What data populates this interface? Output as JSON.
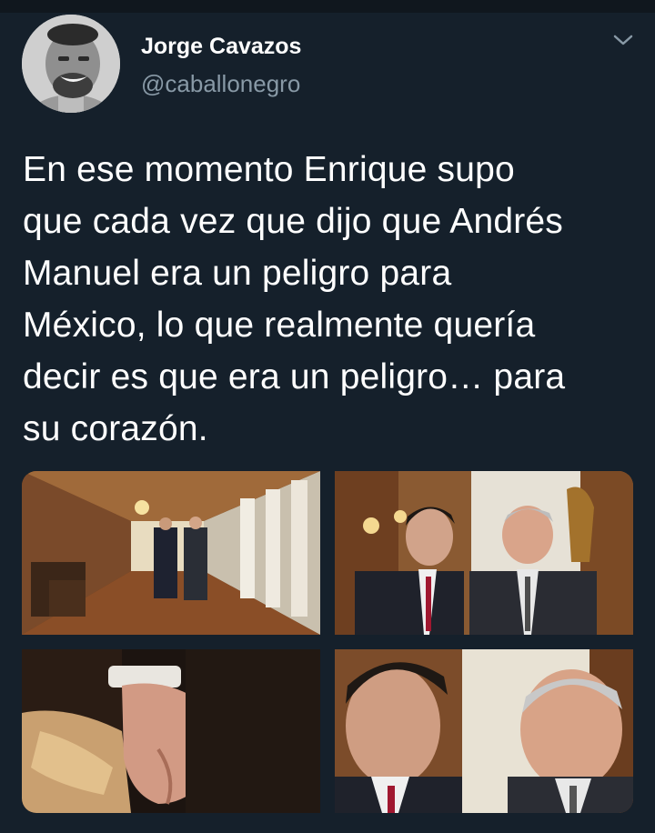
{
  "tweet": {
    "author_name": "Jorge Cavazos",
    "author_handle": "@caballonegro",
    "text": "En ese momento Enrique supo\nque cada vez que dijo que Andrés\nManuel era un peligro para\nMéxico, lo que realmente quería\ndecir es que era un peligro… para\nsu corazón."
  },
  "icons": {
    "avatar": "profile-photo",
    "menu": "chevron-down-icon"
  },
  "colors": {
    "background": "#15202b",
    "text": "#ffffff",
    "secondary_text": "#8899a6"
  }
}
